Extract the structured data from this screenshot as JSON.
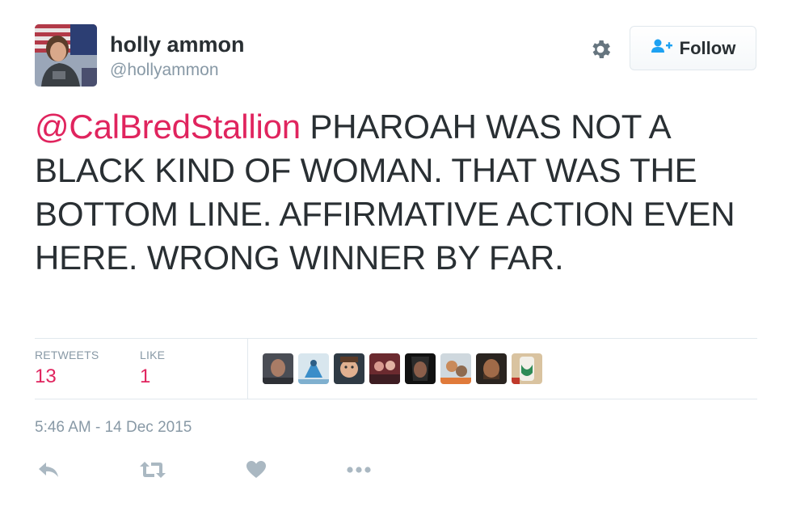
{
  "user": {
    "full_name": "holly ammon",
    "handle": "@hollyammon"
  },
  "follow_button": {
    "label": "Follow"
  },
  "tweet": {
    "mention": "@CalBredStallion",
    "body": " PHAROAH WAS NOT A BLACK KIND OF WOMAN. THAT WAS THE BOTTOM LINE. AFFIRMATIVE ACTION EVEN HERE. WRONG WINNER BY FAR."
  },
  "stats": {
    "retweets_label": "RETWEETS",
    "retweets_value": "13",
    "likes_label": "LIKE",
    "likes_value": "1"
  },
  "timestamp": "5:46 AM - 14 Dec 2015",
  "actions": [
    "reply-icon",
    "retweet-icon",
    "like-heart-icon",
    "more-icon"
  ],
  "colors": {
    "mention": "#e0245e",
    "count": "#e0245e",
    "muted": "#8899a6",
    "text": "#292f33",
    "follow_icon": "#1da1f2"
  }
}
